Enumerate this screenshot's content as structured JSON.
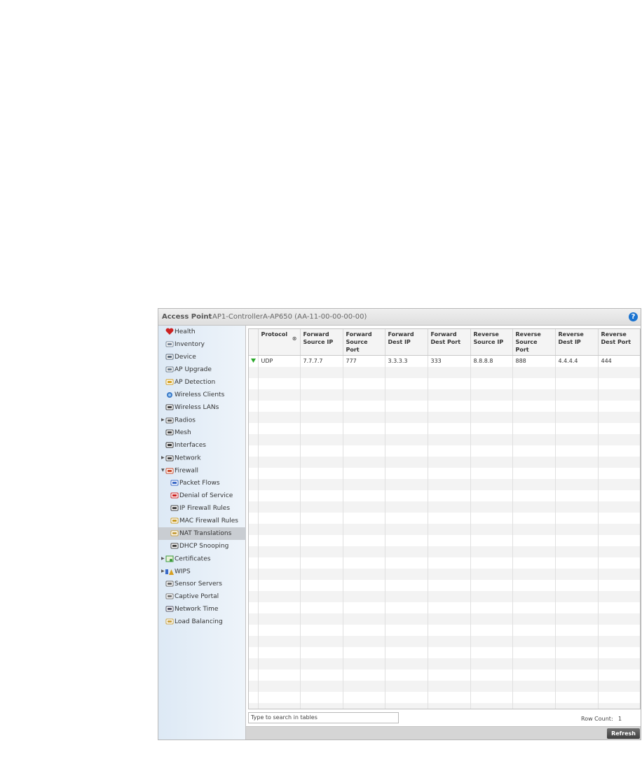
{
  "header": {
    "label": "Access Point",
    "device": "AP1-ControllerA-AP650 (AA-11-00-00-00-00)",
    "help": "?"
  },
  "sidebar": {
    "items": [
      {
        "label": "Health",
        "icon": "health-icon",
        "expand": ""
      },
      {
        "label": "Inventory",
        "icon": "inventory-icon",
        "expand": ""
      },
      {
        "label": "Device",
        "icon": "device-icon",
        "expand": ""
      },
      {
        "label": "AP Upgrade",
        "icon": "ap-upgrade-icon",
        "expand": ""
      },
      {
        "label": "AP Detection",
        "icon": "ap-detection-icon",
        "expand": ""
      },
      {
        "label": "Wireless Clients",
        "icon": "wireless-clients-icon",
        "expand": ""
      },
      {
        "label": "Wireless LANs",
        "icon": "wireless-lans-icon",
        "expand": ""
      },
      {
        "label": "Radios",
        "icon": "radios-icon",
        "expand": "▶"
      },
      {
        "label": "Mesh",
        "icon": "mesh-icon",
        "expand": ""
      },
      {
        "label": "Interfaces",
        "icon": "interfaces-icon",
        "expand": ""
      },
      {
        "label": "Network",
        "icon": "network-icon",
        "expand": "▶"
      },
      {
        "label": "Firewall",
        "icon": "firewall-icon",
        "expand": "▼"
      },
      {
        "label": "Packet Flows",
        "icon": "packet-flows-icon",
        "expand": ""
      },
      {
        "label": "Denial of Service",
        "icon": "denial-of-service-icon",
        "expand": ""
      },
      {
        "label": "IP Firewall Rules",
        "icon": "ip-firewall-rules-icon",
        "expand": ""
      },
      {
        "label": "MAC Firewall Rules",
        "icon": "mac-firewall-rules-icon",
        "expand": ""
      },
      {
        "label": "NAT Translations",
        "icon": "nat-translations-icon",
        "expand": ""
      },
      {
        "label": "DHCP Snooping",
        "icon": "dhcp-snooping-icon",
        "expand": ""
      },
      {
        "label": "Certificates",
        "icon": "certificates-icon",
        "expand": "▶"
      },
      {
        "label": "WIPS",
        "icon": "wips-icon",
        "expand": "▶"
      },
      {
        "label": "Sensor Servers",
        "icon": "sensor-servers-icon",
        "expand": ""
      },
      {
        "label": "Captive Portal",
        "icon": "captive-portal-icon",
        "expand": ""
      },
      {
        "label": "Network Time",
        "icon": "network-time-icon",
        "expand": ""
      },
      {
        "label": "Load Balancing",
        "icon": "load-balancing-icon",
        "expand": ""
      }
    ],
    "selected": "NAT Translations"
  },
  "table": {
    "columns": [
      "",
      "Protocol",
      "Forward Source IP",
      "Forward Source Port",
      "Forward Dest IP",
      "Forward Dest Port",
      "Reverse Source IP",
      "Reverse Source Port",
      "Reverse Dest IP",
      "Reverse Dest Port"
    ],
    "rows": [
      [
        "",
        "UDP",
        "7.7.7.7",
        "777",
        "3.3.3.3",
        "333",
        "8.8.8.8",
        "888",
        "4.4.4.4",
        "444"
      ]
    ]
  },
  "search": {
    "placeholder": "Type to search in tables"
  },
  "footer": {
    "row_count_label": "Row Count:",
    "row_count": "1",
    "refresh_label": "Refresh"
  },
  "colors": {
    "selected_bg": "#c9cdd2",
    "sidebar_bg": "#e4eef7",
    "help_blue": "#1a73d0"
  }
}
